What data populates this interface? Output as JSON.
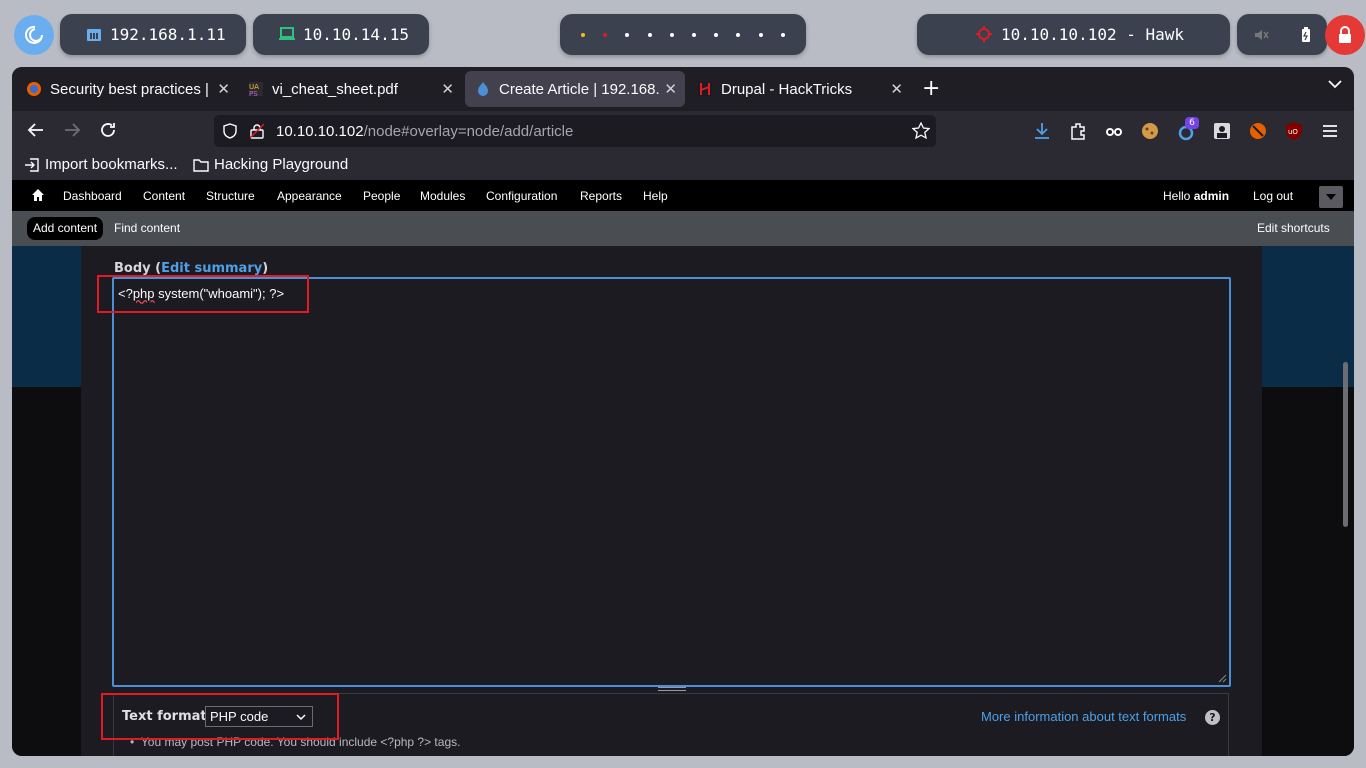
{
  "system_bar": {
    "ip_local": "192.168.1.11",
    "ip_vpn": "10.10.14.15",
    "target": "10.10.10.102 - Hawk",
    "colors": {
      "vpn_icon": "#2ec27e",
      "target_icon": "#e01b24",
      "lock": "#e53935"
    }
  },
  "browser": {
    "tabs": [
      {
        "title": "Security best practices |",
        "icon": "firefox-icon"
      },
      {
        "title": "vi_cheat_sheet.pdf",
        "icon": "pdf-icon"
      },
      {
        "title": "Create Article | 192.168.",
        "icon": "drupal-icon"
      },
      {
        "title": "Drupal - HackTricks",
        "icon": "hacktricks-icon"
      }
    ],
    "url_host": "10.10.10.102",
    "url_path": "/node#overlay=node/add/article",
    "badge_count": "6",
    "bookmarks": [
      {
        "label": "Import bookmarks..."
      },
      {
        "label": "Hacking Playground"
      }
    ]
  },
  "drupal_toolbar": {
    "items": [
      "Dashboard",
      "Content",
      "Structure",
      "Appearance",
      "People",
      "Modules",
      "Configuration",
      "Reports",
      "Help"
    ],
    "hello": "Hello",
    "user": "admin",
    "logout": "Log out"
  },
  "shortcuts": {
    "add_content": "Add content",
    "find_content": "Find content",
    "edit_shortcuts": "Edit shortcuts"
  },
  "form": {
    "body_label": "Body",
    "edit_summary": "Edit summary",
    "code_prefix": "<?",
    "code_php": "php",
    "code_rest": " system(\"whoami\"); ?>",
    "text_format_label": "Text format",
    "text_format_value": "PHP code",
    "more_info": "More information about text formats",
    "tip": "You may post PHP code. You should include <?php ?> tags."
  }
}
